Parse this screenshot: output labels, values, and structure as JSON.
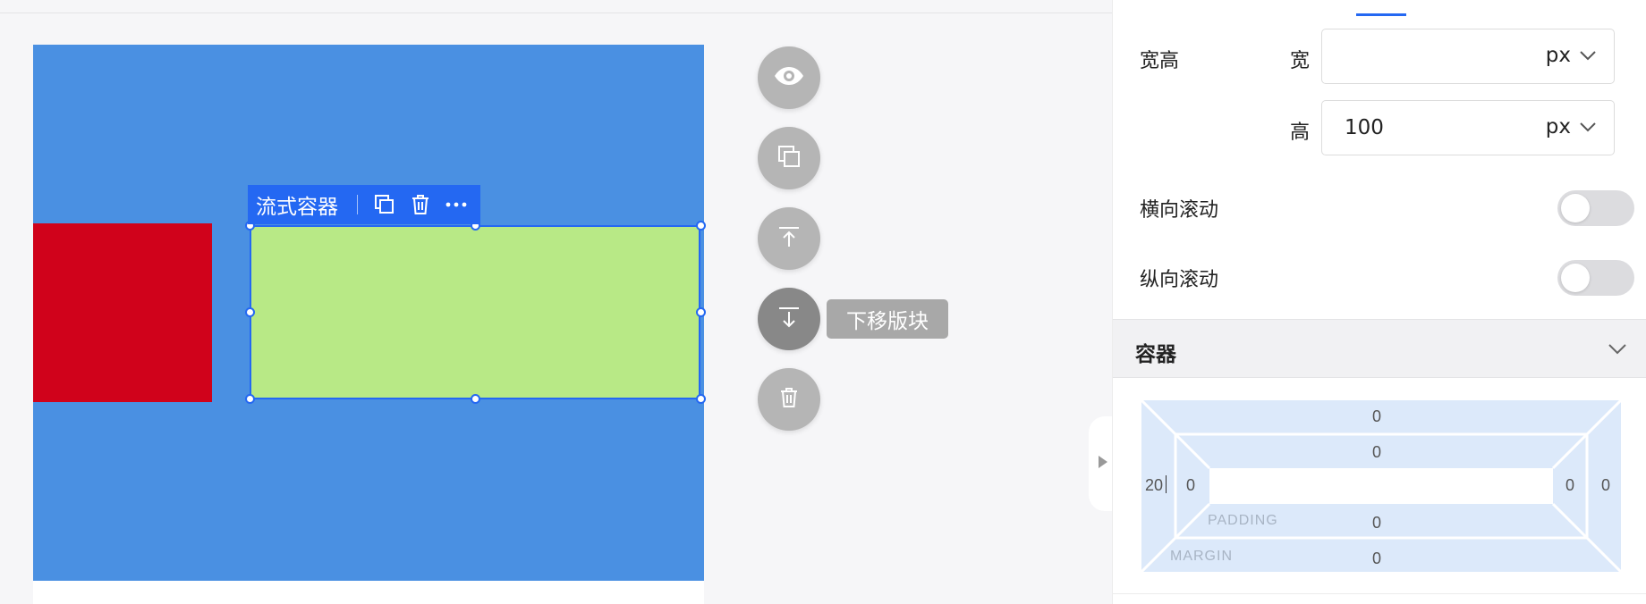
{
  "canvas": {
    "colors": {
      "blue_block": "#4a90e2",
      "red_block": "#d0021b",
      "green_block": "#b8e986",
      "selection": "#2468f2"
    },
    "selection_toolbar": {
      "title": "流式容器",
      "icons": [
        "copy-icon",
        "trash-icon",
        "more-icon"
      ]
    }
  },
  "floating_actions": {
    "buttons": [
      "eye-icon",
      "copy-icon",
      "move-up-icon",
      "move-down-icon",
      "trash-icon"
    ],
    "tooltip": "下移版块"
  },
  "panel": {
    "size": {
      "label": "宽高",
      "width_label": "宽",
      "width_value": "",
      "width_unit": "px",
      "height_label": "高",
      "height_value": "100",
      "height_unit": "px"
    },
    "scroll": {
      "horizontal_label": "横向滚动",
      "horizontal_on": false,
      "vertical_label": "纵向滚动",
      "vertical_on": false
    },
    "section_title": "容器",
    "box_model": {
      "margin_label": "MARGIN",
      "padding_label": "PADDING",
      "margin_top": "0",
      "margin_right": "0",
      "margin_bottom": "0",
      "margin_left": "20",
      "padding_top": "0",
      "padding_right": "0",
      "padding_bottom": "0",
      "padding_left": "0"
    }
  }
}
